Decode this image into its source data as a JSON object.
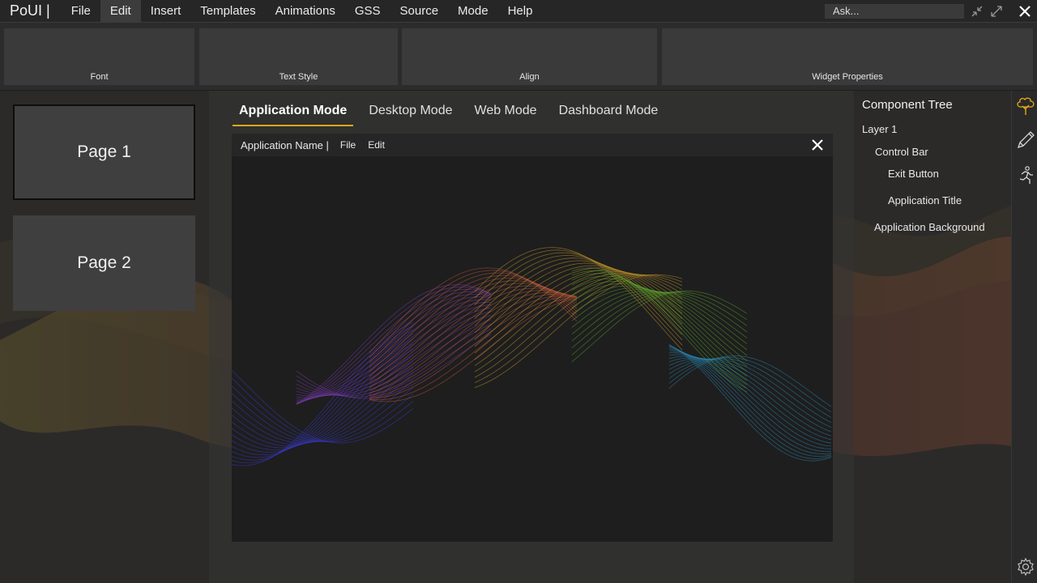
{
  "app": {
    "title": "PoUI |",
    "menu": [
      "File",
      "Edit",
      "Insert",
      "Templates",
      "Animations",
      "GSS",
      "Source",
      "Mode",
      "Help"
    ],
    "active_menu": "Edit",
    "ask_placeholder": "Ask...",
    "window_icons": [
      "minimize-arrows-icon",
      "maximize-arrows-icon",
      "close-icon"
    ]
  },
  "ribbon": {
    "groups": [
      "Font",
      "Text Style",
      "Align",
      "Widget Properties"
    ]
  },
  "pages": {
    "items": [
      "Page 1",
      "Page 2"
    ],
    "selected": "Page 1"
  },
  "modes": {
    "tabs": [
      "Application Mode",
      "Desktop Mode",
      "Web Mode",
      "Dashboard Mode"
    ],
    "active": "Application Mode"
  },
  "preview": {
    "app_name": "Application Name |",
    "menu": [
      "File",
      "Edit"
    ],
    "close_icon": "close-icon"
  },
  "component_tree": {
    "title": "Component Tree",
    "items": [
      "Layer 1",
      "Control Bar",
      "Exit Button",
      "Application Title",
      "Application Background"
    ]
  },
  "sidebar_icons": [
    "tree-icon",
    "pencil-icon",
    "running-person-icon",
    "gear-icon"
  ],
  "colors": {
    "accent": "#e6a817",
    "background": "#2b2a29",
    "panel": "#3f3f3f"
  }
}
